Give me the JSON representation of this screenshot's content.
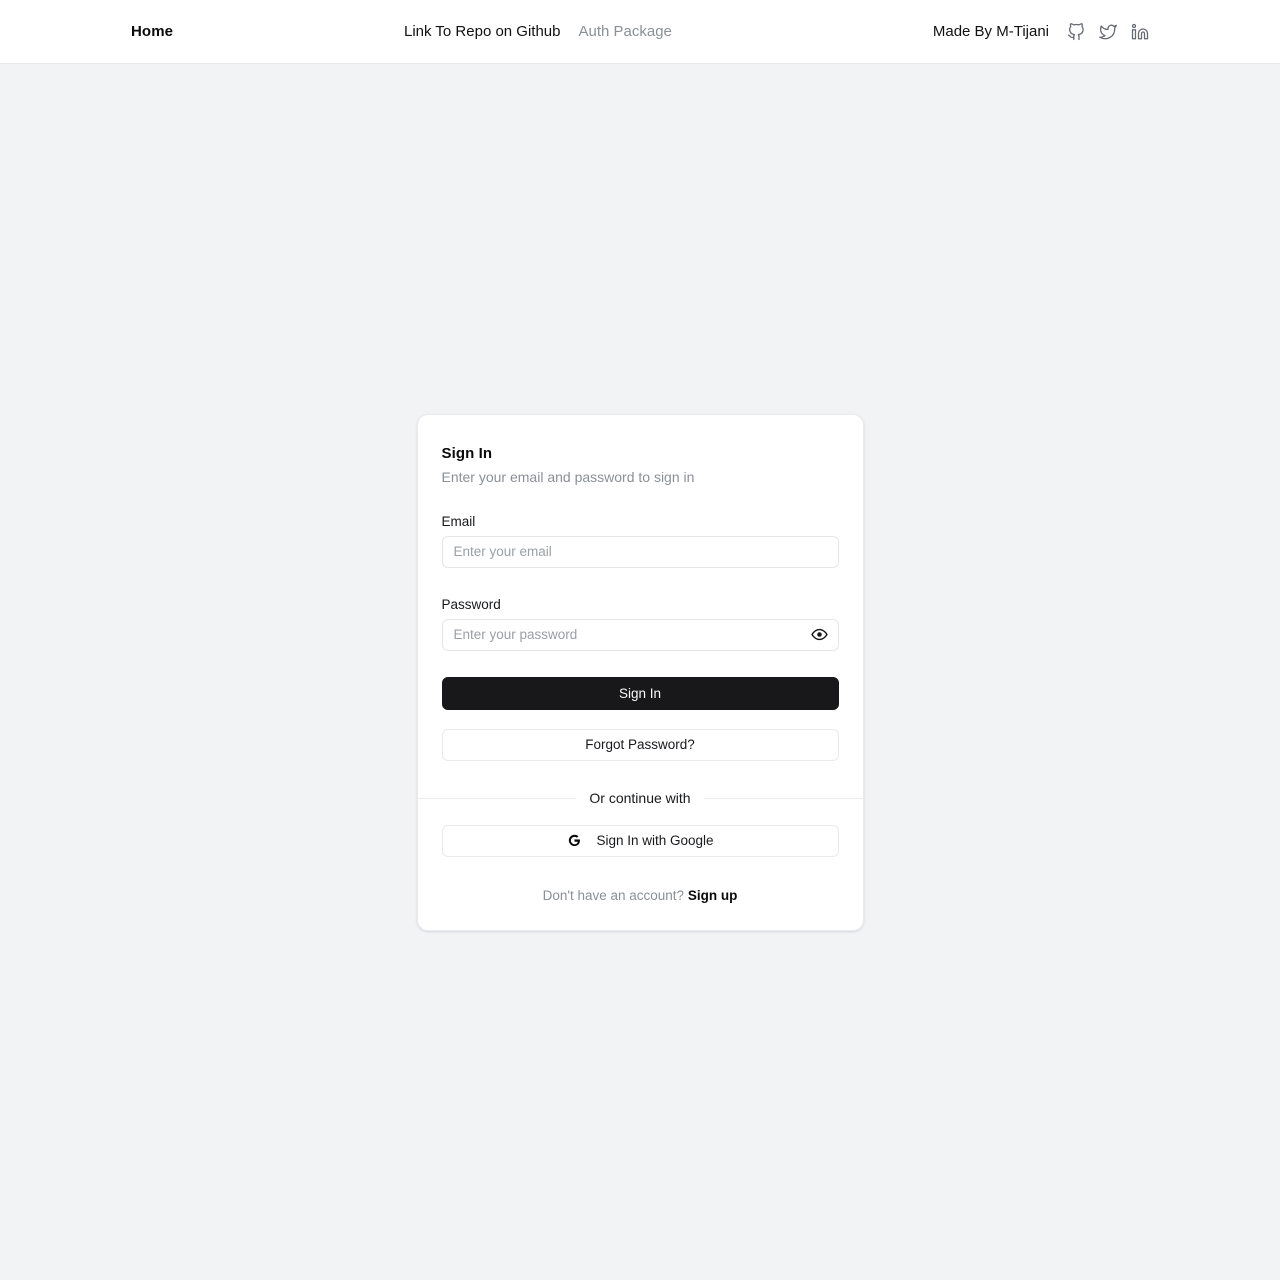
{
  "navbar": {
    "home_label": "Home",
    "repo_link_label": "Link To Repo on Github",
    "package_label": "Auth Package",
    "author_label": "Made By M-Tijani",
    "social": [
      {
        "name": "github-icon",
        "label": "GitHub"
      },
      {
        "name": "twitter-icon",
        "label": "Twitter"
      },
      {
        "name": "linkedin-icon",
        "label": "LinkedIn"
      }
    ]
  },
  "auth_card": {
    "title": "Sign In",
    "subtitle": "Enter your email and password to sign in",
    "email": {
      "label": "Email",
      "placeholder": "Enter your email",
      "value": ""
    },
    "password": {
      "label": "Password",
      "placeholder": "Enter your password",
      "value": "",
      "toggle_icon": "eye-icon"
    },
    "submit_label": "Sign In",
    "forgot_label": "Forgot Password?",
    "divider_label": "Or continue with",
    "google_label": "Sign In with Google",
    "google_icon": "google-g-icon",
    "footer_prompt": "Don't have an account?",
    "footer_action": "Sign up"
  },
  "colors": {
    "page_background": "#f1f3f5",
    "navbar_background": "#ffffff",
    "card_background": "#ffffff",
    "primary_button": "#18181b",
    "primary_button_text": "#fafafa",
    "border": "#e8eaed",
    "muted_text": "#8b9096",
    "body_text": "#17191c"
  }
}
